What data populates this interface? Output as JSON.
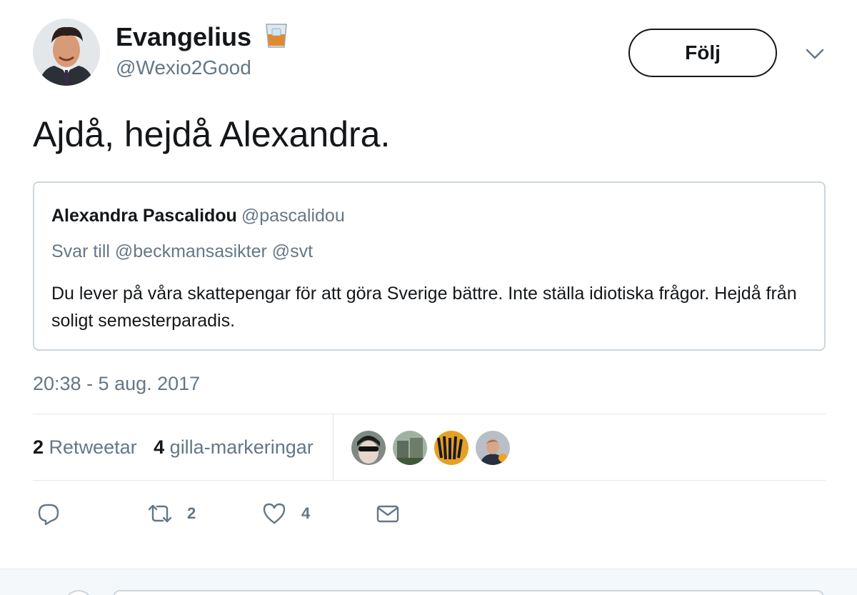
{
  "author": {
    "display_name": "Evangelius",
    "handle": "@Wexio2Good",
    "emoji": "whisky-glass-emoji"
  },
  "follow_label": "Följ",
  "tweet_text": "Ajdå, hejdå Alexandra.",
  "quoted_tweet": {
    "name": "Alexandra Pascalidou",
    "handle": "@pascalidou",
    "reply_to": "Svar till @beckmansasikter @svt",
    "body": "Du lever på våra skattepengar för att göra Sverige bättre. Inte ställa idiotiska frågor. Hejdå från soligt semesterparadis."
  },
  "timestamp": "20:38 - 5 aug. 2017",
  "stats": {
    "retweets_count": "2",
    "retweets_label": "Retweetar",
    "likes_count": "4",
    "likes_label": "gilla-markeringar"
  },
  "likers": [
    "liker-avatar-1",
    "liker-avatar-2",
    "liker-avatar-3",
    "liker-avatar-4"
  ],
  "actions": {
    "reply_icon": "reply-icon",
    "retweet_icon": "retweet-icon",
    "retweet_count": "2",
    "like_icon": "heart-icon",
    "like_count": "4",
    "dm_icon": "envelope-icon"
  },
  "colors": {
    "text": "#14171a",
    "secondary": "#657786",
    "border": "#ccd6dd",
    "divider": "#e1e8ed"
  }
}
